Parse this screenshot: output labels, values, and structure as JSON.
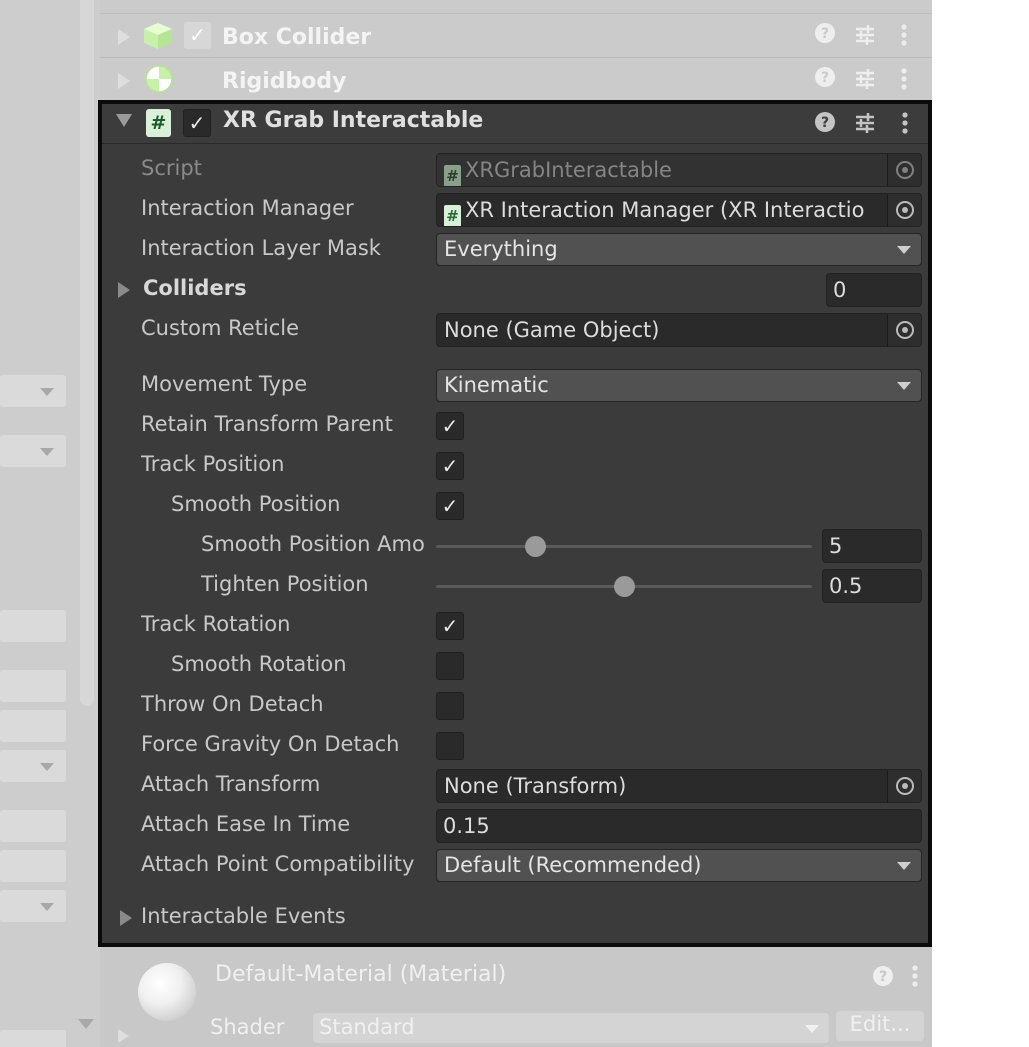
{
  "collapsed_components": [
    {
      "name": "Box Collider",
      "enabled": true
    },
    {
      "name": "Rigidbody"
    }
  ],
  "xr_grab": {
    "title": "XR Grab Interactable",
    "enabled": true,
    "script": {
      "label": "Script",
      "value": "XRGrabInteractable"
    },
    "interaction_manager": {
      "label": "Interaction Manager",
      "value": "XR Interaction Manager (XR Interactio"
    },
    "interaction_layer_mask": {
      "label": "Interaction Layer Mask",
      "value": "Everything"
    },
    "colliders": {
      "label": "Colliders",
      "count": "0"
    },
    "custom_reticle": {
      "label": "Custom Reticle",
      "value": "None (Game Object)"
    },
    "movement_type": {
      "label": "Movement Type",
      "value": "Kinematic"
    },
    "retain_transform_parent": {
      "label": "Retain Transform Parent",
      "checked": true
    },
    "track_position": {
      "label": "Track Position",
      "checked": true
    },
    "smooth_position": {
      "label": "Smooth Position",
      "checked": true
    },
    "smooth_position_amount": {
      "label": "Smooth Position Amo",
      "value": "5",
      "min": 0,
      "max": 20
    },
    "tighten_position": {
      "label": "Tighten Position",
      "value": "0.5",
      "min": 0,
      "max": 1
    },
    "track_rotation": {
      "label": "Track Rotation",
      "checked": true
    },
    "smooth_rotation": {
      "label": "Smooth Rotation",
      "checked": false
    },
    "throw_on_detach": {
      "label": "Throw On Detach",
      "checked": false
    },
    "force_gravity_on_detach": {
      "label": "Force Gravity On Detach",
      "checked": false
    },
    "attach_transform": {
      "label": "Attach Transform",
      "value": "None (Transform)"
    },
    "attach_ease_in_time": {
      "label": "Attach Ease In Time",
      "value": "0.15"
    },
    "attach_point_compatibility": {
      "label": "Attach Point Compatibility",
      "value": "Default (Recommended)"
    },
    "interactable_events": {
      "label": "Interactable Events"
    }
  },
  "material": {
    "name": "Default-Material (Material)",
    "shader_label": "Shader",
    "shader_value": "Standard",
    "edit_label": "Edit..."
  },
  "icons": {
    "help": "help-icon",
    "presets": "preset-sliders-icon",
    "menu": "kebab-menu-icon",
    "object_picker": "object-picker-icon",
    "script": "script-hash-icon"
  },
  "colors": {
    "panel_bg": "#3b3b3b",
    "field_bg": "#2a2a2a",
    "selection_border": "#0b0b0b"
  }
}
